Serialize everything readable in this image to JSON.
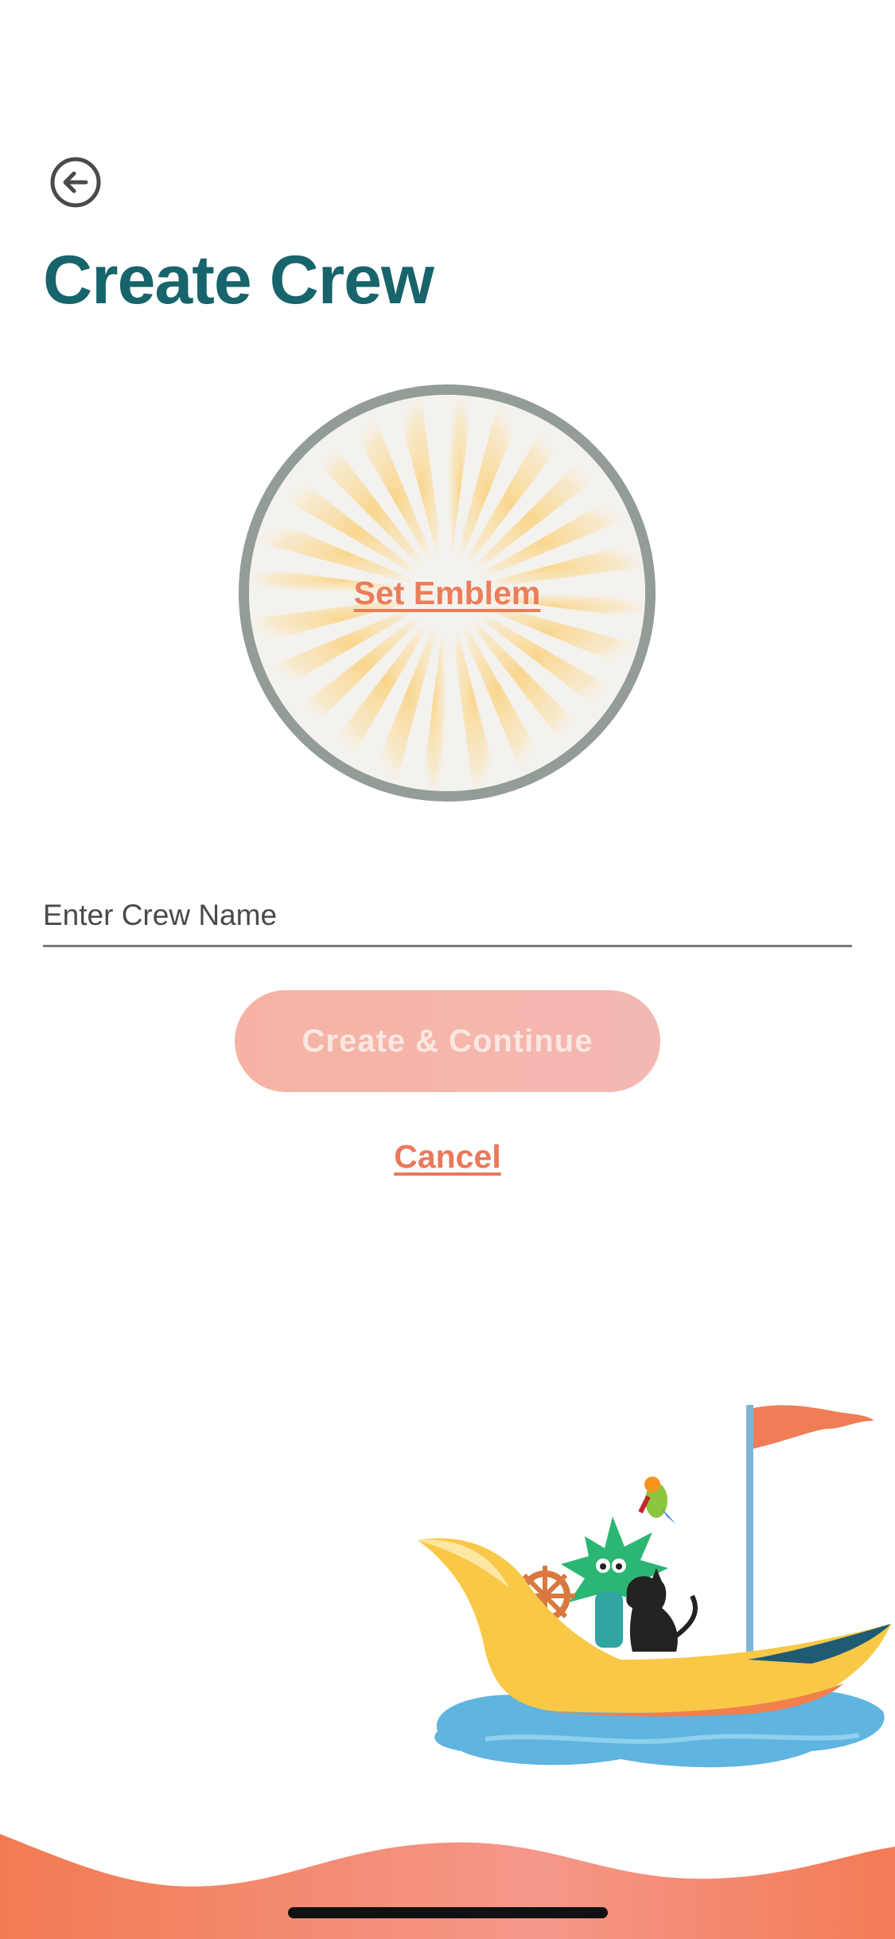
{
  "header": {
    "back_icon": "arrow-left-circle-icon",
    "title": "Create Crew"
  },
  "emblem": {
    "label": "Set Emblem",
    "colors": {
      "ring": "#939c96",
      "rays": "#f8d89a",
      "background": "#f4f2ee"
    }
  },
  "form": {
    "crew_name_value": "",
    "crew_name_placeholder": "Enter Crew Name"
  },
  "actions": {
    "create_label": "Create & Continue",
    "cancel_label": "Cancel"
  },
  "colors": {
    "title": "#17646b",
    "accent": "#ec7d5a",
    "button_disabled": "#f6b3a3"
  },
  "illustration": {
    "icon": "pirate-boat-illustration"
  }
}
